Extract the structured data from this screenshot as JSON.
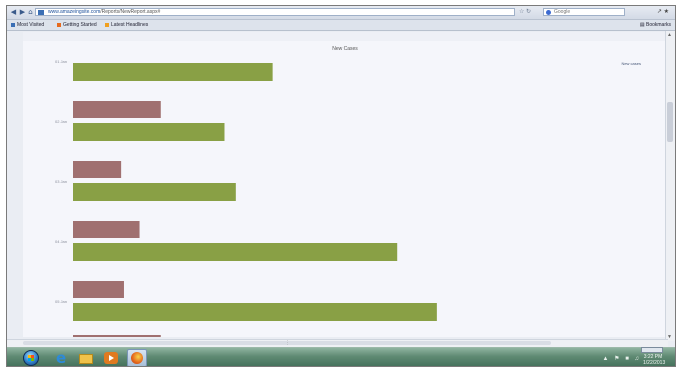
{
  "browser": {
    "url_host": "www.amazeingsite.com",
    "url_path": "/Reports/NewReport.aspx#",
    "search_placeholder": "Google",
    "toolbar_right": "↗ ★",
    "bookmarks": [
      {
        "label": "Most Visited",
        "icon_color": "#3b6fb5"
      },
      {
        "label": "Getting Started",
        "icon_color": "#e66a1e"
      },
      {
        "label": "Latest Headlines",
        "icon_color": "#f0a020"
      }
    ],
    "bookmarks_right": "Bookmarks"
  },
  "chart_data": {
    "type": "bar",
    "orientation": "horizontal",
    "title": "New Cases",
    "legend_label": "New cases",
    "categories": [
      "01 Jan",
      "02 Jan",
      "03 Jan",
      "04 Jan",
      "05 Jan"
    ],
    "series": [
      {
        "name": "",
        "color": "#a07070",
        "values": [
          null,
          62,
          34,
          47,
          36
        ]
      },
      {
        "name": "New cases",
        "color": "#89a045",
        "values": [
          141,
          107,
          115,
          229,
          257
        ]
      }
    ],
    "partial_bar_value": 62,
    "xlim": [
      0,
      380
    ],
    "grid": false,
    "legend_position": "top-right"
  },
  "taskbar": {
    "lang_badge": "",
    "clock_time": "3:22 PM",
    "clock_date": "1/22/2013",
    "tray_icons": "▲ ⚑ ■ ♫"
  }
}
